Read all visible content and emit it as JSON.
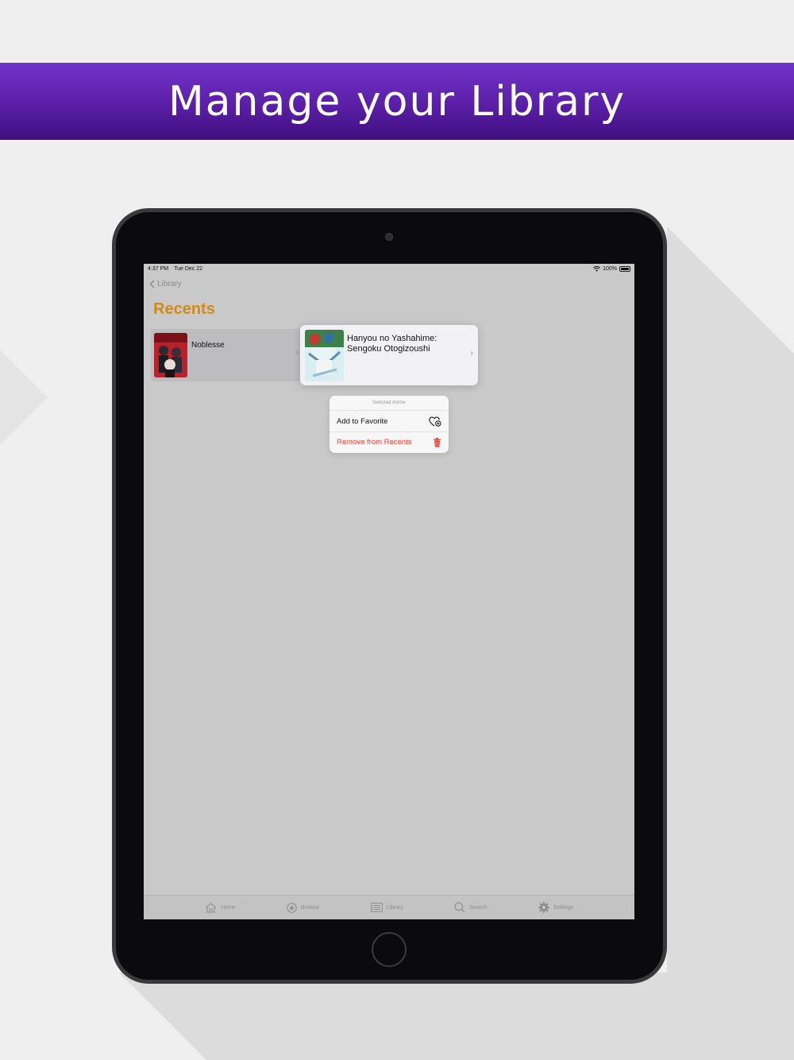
{
  "banner": {
    "title": "Manage your Library"
  },
  "status": {
    "time": "4:37 PM",
    "date": "Tue Dec 22",
    "battery": "100%"
  },
  "nav": {
    "back_label": "Library",
    "title": "Recents"
  },
  "recents": {
    "items": [
      {
        "title": "Noblesse"
      }
    ]
  },
  "preview": {
    "title": "Hanyou no Yashahime: Sengoku Otogizoushi"
  },
  "menu": {
    "header": "Selected Anime",
    "add_favorite": "Add to Favorite",
    "remove_recents": "Remove from Recents"
  },
  "tabbar": {
    "tabs": [
      {
        "label": "Home",
        "icon": "home-icon"
      },
      {
        "label": "Browse",
        "icon": "browse-icon"
      },
      {
        "label": "Library",
        "icon": "library-icon"
      },
      {
        "label": "Search",
        "icon": "search-icon"
      },
      {
        "label": "Settings",
        "icon": "gear-icon"
      }
    ]
  },
  "colors": {
    "banner": "#5a1fa6",
    "accent": "#d48a12",
    "destructive": "#ff3b30"
  }
}
